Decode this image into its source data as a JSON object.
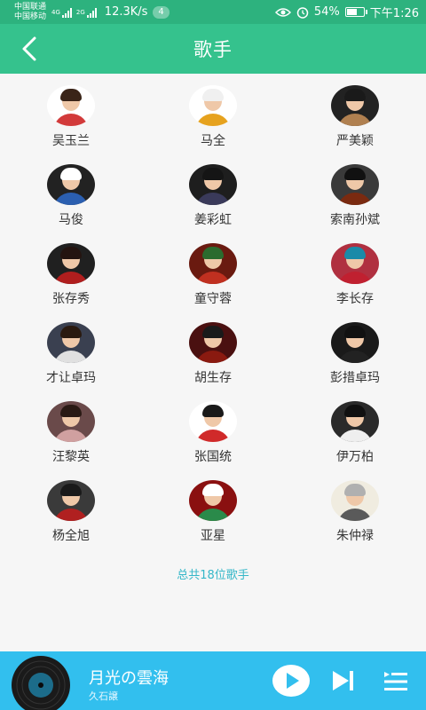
{
  "status": {
    "carrier1": "中国联通",
    "carrier2": "中国移动",
    "net1": "4G",
    "net2": "2G",
    "speed": "12.3K/s",
    "badge": "4",
    "battery": "54%",
    "battery_level": 0.54,
    "time": "下午1:26"
  },
  "header": {
    "title": "歌手"
  },
  "singers": [
    {
      "name": "吴玉兰",
      "hair": "#3a2418",
      "body": "#d23a3a",
      "bg": "#ffffff"
    },
    {
      "name": "马全",
      "hair": "#f0f0f0",
      "body": "#e6a21e",
      "bg": "#ffffff"
    },
    {
      "name": "严美颖",
      "hair": "#1a1a1a",
      "body": "#b08050",
      "bg": "#222222"
    },
    {
      "name": "马俊",
      "hair": "#ffffff",
      "body": "#2b5fb0",
      "bg": "#222222"
    },
    {
      "name": "姜彩虹",
      "hair": "#151515",
      "body": "#3a3a5a",
      "bg": "#1e1e1e"
    },
    {
      "name": "索南孙斌",
      "hair": "#111111",
      "body": "#7a2a10",
      "bg": "#3a3a3a"
    },
    {
      "name": "张存秀",
      "hair": "#241410",
      "body": "#b01e1e",
      "bg": "#202020"
    },
    {
      "name": "童守蓉",
      "hair": "#2b6b2e",
      "body": "#c03020",
      "bg": "#6a1a10"
    },
    {
      "name": "李长存",
      "hair": "#1a8aa8",
      "body": "#c02030",
      "bg": "#b03040"
    },
    {
      "name": "才让卓玛",
      "hair": "#2a1a10",
      "body": "#e0e0e0",
      "bg": "#3a4050"
    },
    {
      "name": "胡生存",
      "hair": "#1a1a1a",
      "body": "#8a1a10",
      "bg": "#4a1010"
    },
    {
      "name": "彭措卓玛",
      "hair": "#111111",
      "body": "#222222",
      "bg": "#1a1a1a"
    },
    {
      "name": "汪黎英",
      "hair": "#2a1a14",
      "body": "#d0a0a0",
      "bg": "#6a4a4a"
    },
    {
      "name": "张国统",
      "hair": "#1a1a1a",
      "body": "#d02a2a",
      "bg": "#ffffff"
    },
    {
      "name": "伊万柏",
      "hair": "#101010",
      "body": "#eeeeee",
      "bg": "#2a2a2a"
    },
    {
      "name": "杨全旭",
      "hair": "#1a1a1a",
      "body": "#b02020",
      "bg": "#3a3a3a"
    },
    {
      "name": "亚星",
      "hair": "#ffffff",
      "body": "#2a8a4a",
      "bg": "#8a1010"
    },
    {
      "name": "朱仲禄",
      "hair": "#b0b0b0",
      "body": "#5a5a5a",
      "bg": "#f0ece0"
    }
  ],
  "footer": {
    "total_text": "总共18位歌手"
  },
  "player": {
    "song": "月光の雲海",
    "artist": "久石譲"
  },
  "colors": {
    "statusbar": "#2db27e",
    "titlebar": "#35c28d",
    "player": "#32bfee",
    "total_text": "#35b7c8"
  }
}
